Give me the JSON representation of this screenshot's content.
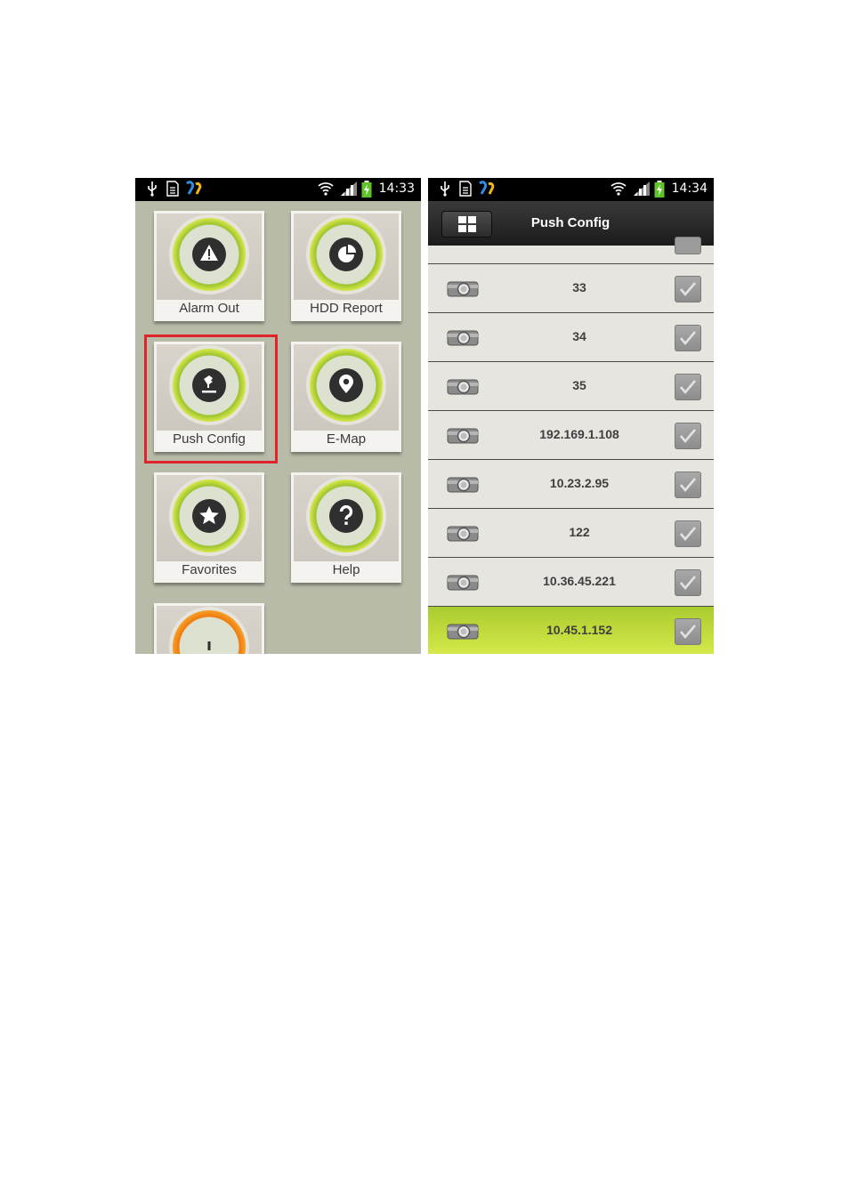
{
  "left_screen": {
    "status_time": "14:33",
    "tiles": [
      {
        "label": "Alarm Out",
        "icon": "warning-icon"
      },
      {
        "label": "HDD Report",
        "icon": "pie-chart-icon"
      },
      {
        "label": "Push Config",
        "icon": "push-upload-icon"
      },
      {
        "label": "E-Map",
        "icon": "map-pin-icon"
      },
      {
        "label": "Favorites",
        "icon": "star-icon"
      },
      {
        "label": "Help",
        "icon": "question-icon"
      }
    ],
    "highlight_color": "#e0242b"
  },
  "right_screen": {
    "status_time": "14:34",
    "title": "Push Config",
    "devices": [
      {
        "name": "33",
        "checked": true
      },
      {
        "name": "34",
        "checked": true
      },
      {
        "name": "35",
        "checked": true
      },
      {
        "name": "192.169.1.108",
        "checked": true
      },
      {
        "name": "10.23.2.95",
        "checked": true
      },
      {
        "name": "122",
        "checked": true
      },
      {
        "name": "10.36.45.221",
        "checked": true
      },
      {
        "name": "10.45.1.152",
        "checked": true,
        "selected": true
      }
    ],
    "selected_color": "#c4df3c"
  }
}
